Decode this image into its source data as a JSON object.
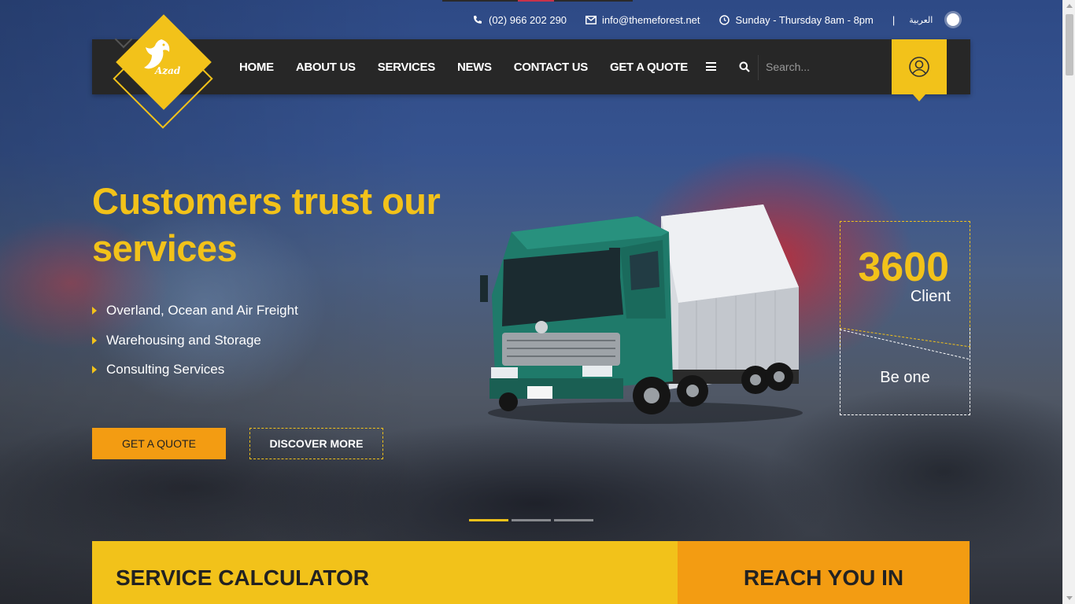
{
  "topbar": {
    "phone": "(02) 966 202 290",
    "email": "info@themeforest.net",
    "hours": "Sunday - Thursday 8am - 8pm",
    "separator": "|",
    "language": "العربية"
  },
  "logo": {
    "name": "Azad"
  },
  "nav": {
    "items": [
      {
        "label": "HOME"
      },
      {
        "label": "ABOUT US"
      },
      {
        "label": "SERVICES"
      },
      {
        "label": "NEWS"
      },
      {
        "label": "CONTACT US"
      },
      {
        "label": "GET A QUOTE"
      }
    ],
    "search_placeholder": "Search..."
  },
  "hero": {
    "headline": "Customers trust our services",
    "features": [
      "Overland, Ocean and Air Freight",
      "Warehousing and Storage",
      "Consulting Services"
    ],
    "primary_button": "GET A QUOTE",
    "secondary_button": "DISCOVER MORE"
  },
  "stat": {
    "number": "3600",
    "label": "Client",
    "cta": "Be one"
  },
  "slider": {
    "count": 3,
    "active": 0
  },
  "panels": {
    "calculator_title": "SERVICE CALCULATOR",
    "reach_title": "REACH YOU IN"
  },
  "colors": {
    "accent_yellow": "#f2c21a",
    "accent_orange": "#f39c12",
    "nav_bg": "#272727"
  }
}
